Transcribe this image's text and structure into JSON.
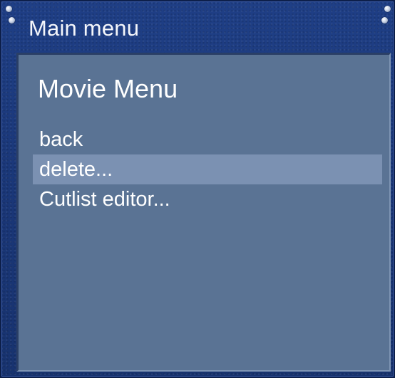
{
  "window": {
    "title": "Main menu"
  },
  "content": {
    "heading": "Movie Menu",
    "items": [
      {
        "label": "back",
        "selected": false
      },
      {
        "label": "delete...",
        "selected": true
      },
      {
        "label": "Cutlist editor...",
        "selected": false
      }
    ]
  },
  "colors": {
    "frame": "#1f3f86",
    "panel": "#5a7394",
    "selection": "#7b91b2",
    "text": "#ffffff"
  }
}
